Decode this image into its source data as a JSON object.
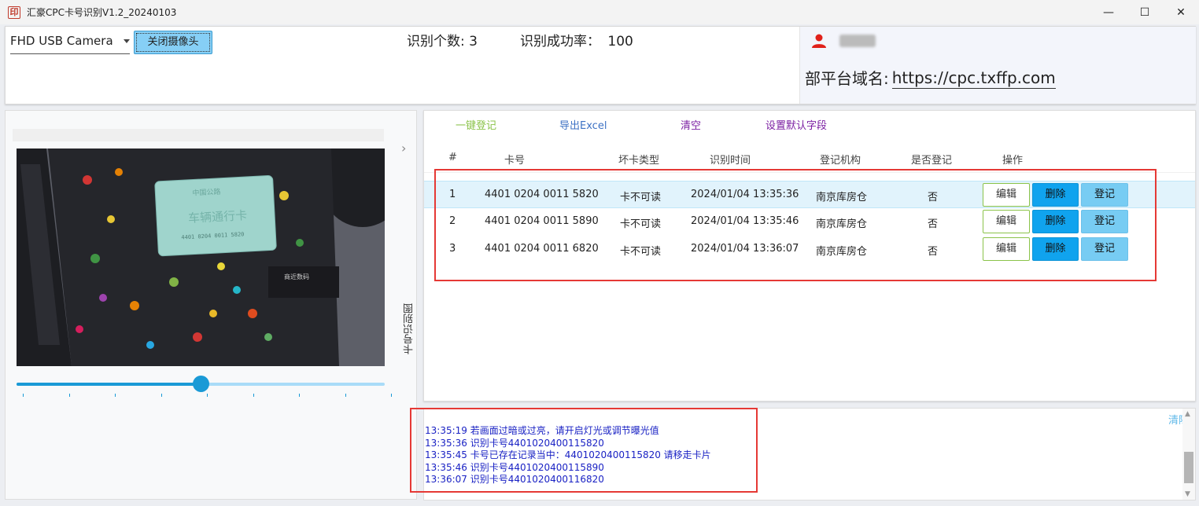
{
  "window": {
    "title": "汇豪CPC卡号识别V1.2_20240103",
    "icon_name": "app-seal-icon",
    "controls": {
      "minimize": "—",
      "maximize": "☐",
      "close": "✕"
    }
  },
  "header": {
    "camera_select": "FHD USB Camera",
    "close_camera_label": "关闭摄像头",
    "recognized_count": "识别个数: 3",
    "success_rate_label": "识别成功率：",
    "success_rate_value": "100",
    "user_icon": "person-icon",
    "domain_label": "部平台域名:",
    "domain_value": "https://cpc.txffp.com"
  },
  "camera": {
    "side_tab_label": "卡号识别图",
    "card_text_title": "车辆通行卡",
    "card_text_header": "中国公路",
    "card_number_print": "4401 0204 0011 5820",
    "mat_caption": "商近数码",
    "exposure_fraction": 0.5
  },
  "toolbar": {
    "register_all": "一键登记",
    "export_excel": "导出Excel",
    "clear": "清空",
    "set_defaults": "设置默认字段"
  },
  "table": {
    "headers": [
      "#",
      "卡号",
      "坏卡类型",
      "识别时间",
      "登记机构",
      "是否登记",
      "操作"
    ],
    "action_labels": {
      "edit": "编辑",
      "delete": "删除",
      "register": "登记"
    },
    "rows": [
      {
        "index": "1",
        "card_no": "4401 0204 0011 5820",
        "bad_type": "卡不可读",
        "time": "2024/01/04 13:35:36",
        "org": "南京库房仓",
        "registered": "否"
      },
      {
        "index": "2",
        "card_no": "4401 0204 0011 5890",
        "bad_type": "卡不可读",
        "time": "2024/01/04 13:35:46",
        "org": "南京库房仓",
        "registered": "否"
      },
      {
        "index": "3",
        "card_no": "4401 0204 0011 6820",
        "bad_type": "卡不可读",
        "time": "2024/01/04 13:36:07",
        "org": "南京库房仓",
        "registered": "否"
      }
    ]
  },
  "log": {
    "clear_label": "清除",
    "lines": [
      "13:35:19 若画面过暗或过亮，请开启灯光或调节曝光值",
      "13:35:36 识别卡号4401020400115820",
      "13:35:45 卡号已存在记录当中：4401020400115820 请移走卡片",
      "13:35:46 识别卡号4401020400115890",
      "13:36:07 识别卡号4401020400116820"
    ]
  },
  "colors": {
    "accent": "#1a9ad6",
    "highlight_box": "#e53935",
    "log_text": "#1a22c4"
  }
}
